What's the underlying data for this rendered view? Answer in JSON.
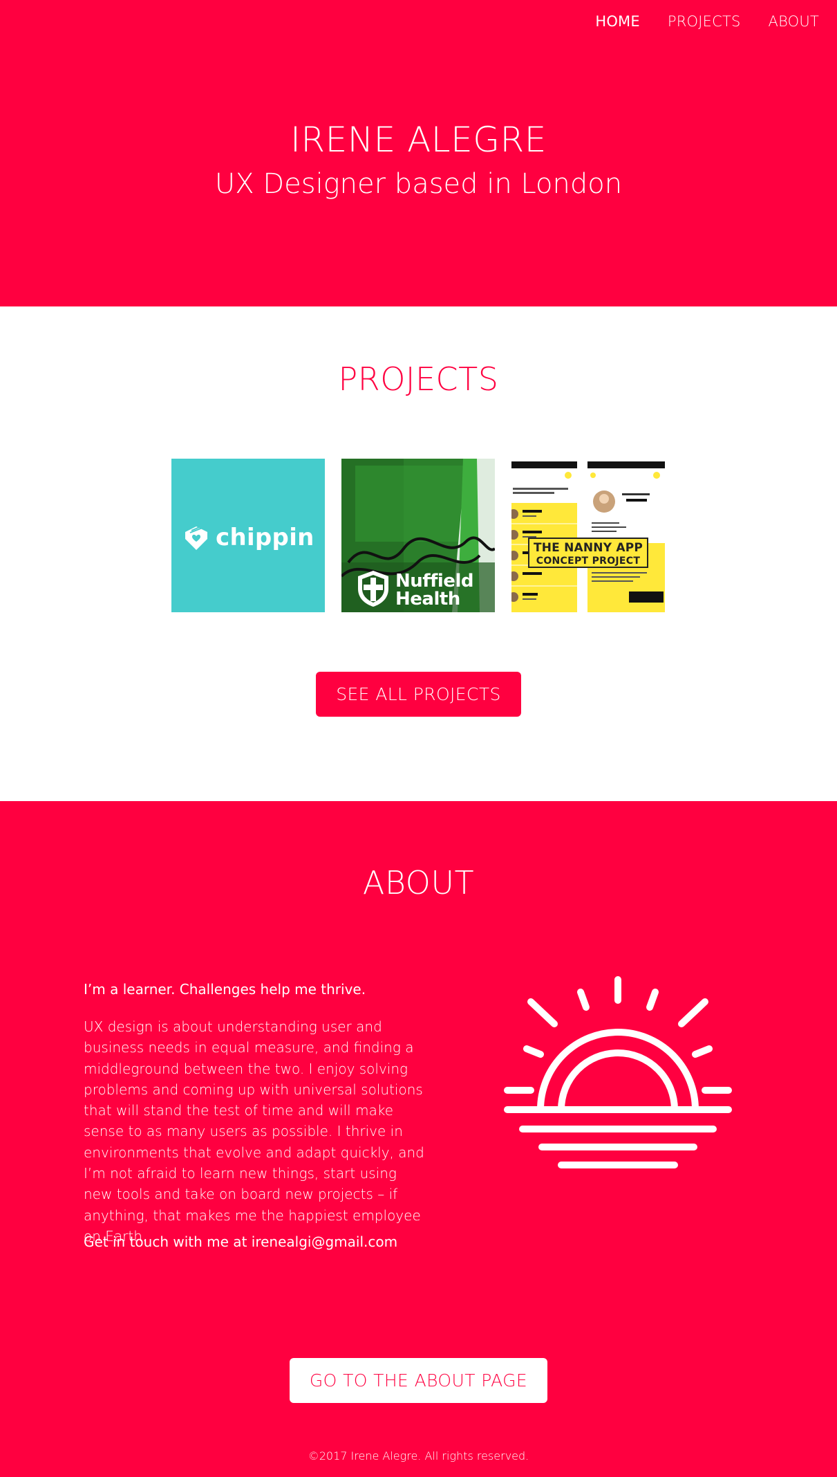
{
  "nav": {
    "items": [
      {
        "label": "HOME",
        "active": true
      },
      {
        "label": "PROJECTS",
        "active": false
      },
      {
        "label": "ABOUT",
        "active": false
      }
    ]
  },
  "hero": {
    "title": "IRENE ALEGRE",
    "subtitle": "UX Designer based in London"
  },
  "projects": {
    "heading": "PROJECTS",
    "tiles": [
      {
        "logo_text": "chippin",
        "icon": "price-tag-heart-icon",
        "color": "#45cccc"
      },
      {
        "logo_text_line1": "Nuffield",
        "logo_text_line2": "Health",
        "icon": "shield-cross-icon",
        "color": "#2f8f2f"
      },
      {
        "title": "THE NANNY APP",
        "subtitle": "CONCEPT PROJECT",
        "color": "#ffe83a"
      }
    ],
    "button_label": "SEE ALL PROJECTS"
  },
  "about": {
    "heading": "ABOUT",
    "lead": "I’m a learner. Challenges help me thrive.",
    "body": "UX design is about understanding user and business needs in equal measure, and finding a middleground between the two. I enjoy solving problems and coming up with universal solutions that will stand the test of time and will make sense to as many users as possible. I thrive in environments that evolve and adapt quickly, and I’m not afraid to learn new things, start using new tools and take on board new projects – if anything, that makes me the happiest employee on Earth.",
    "contact": "Get in touch with me at irenealgi@gmail.com",
    "illustration": "sunrise-icon",
    "button_label": "GO TO THE ABOUT PAGE"
  },
  "footer": {
    "copyright": "©2017 Irene Alegre. All rights reserved."
  },
  "colors": {
    "brand": "#ff0040",
    "white": "#ffffff"
  }
}
